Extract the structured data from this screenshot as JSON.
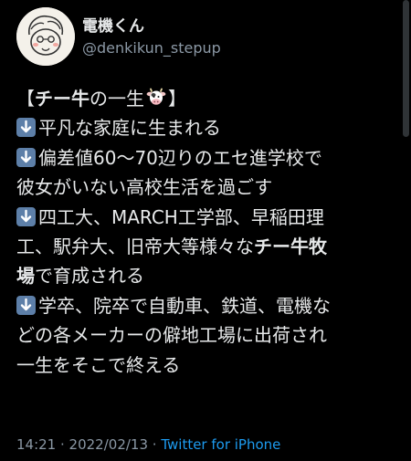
{
  "user": {
    "display_name": "電機くん",
    "handle": "@denkikun_stepup"
  },
  "tweet": {
    "title_open": "【",
    "title_bold": "チー牛",
    "title_rest": "の一生",
    "title_close": "】",
    "line1": "平凡な家庭に生まれる",
    "line2": "偏差値60〜70辺りのエセ進学校で",
    "line3": "彼女がいない高校生活を過ごす",
    "line4": "四工大、MARCH工学部、早稲田理",
    "line5_a": "工、駅弁大、旧帝大等様々な",
    "line5_bold": "チー牛牧",
    "line6_bold": "場",
    "line6_rest": "で育成される",
    "line7": "学卒、院卒で自動車、鉄道、電機な",
    "line8": "どの各メーカーの僻地工場に出荷され",
    "line9": "一生をそこで終える"
  },
  "meta": {
    "time": "14:21",
    "sep1": " · ",
    "date": "2022/02/13",
    "sep2": " · ",
    "source": "Twitter for iPhone"
  },
  "icons": {
    "down_arrow": "down-arrow-emoji-icon",
    "cow": "cow-face-emoji-icon"
  },
  "colors": {
    "background": "#000000",
    "text": "#e7e9ea",
    "secondary": "#8b98a5",
    "link": "#1d9bf0"
  }
}
